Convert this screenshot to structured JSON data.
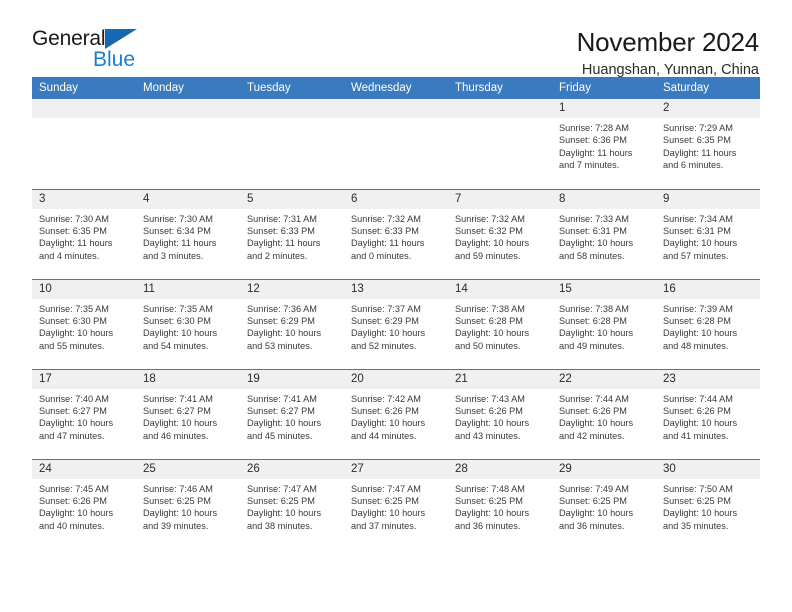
{
  "logo": {
    "word_one": "General",
    "word_two": "Blue",
    "triangle_icon": "blue-triangle-icon",
    "accent_color": "#1668b3",
    "blue_text_color": "#1b7fd4"
  },
  "header": {
    "title": "November 2024",
    "subtitle": "Huangshan, Yunnan, China"
  },
  "theme": {
    "header_row_bg": "#3a7abf",
    "header_row_text": "#ffffff",
    "daynum_band_bg": "#f0f0f0",
    "row_divider": "#3a7abf"
  },
  "weekdays": [
    "Sunday",
    "Monday",
    "Tuesday",
    "Wednesday",
    "Thursday",
    "Friday",
    "Saturday"
  ],
  "labels": {
    "sunrise_prefix": "Sunrise:",
    "sunset_prefix": "Sunset:",
    "daylight_prefix": "Daylight:"
  },
  "weeks": [
    [
      {
        "day": "",
        "empty": true
      },
      {
        "day": "",
        "empty": true
      },
      {
        "day": "",
        "empty": true
      },
      {
        "day": "",
        "empty": true
      },
      {
        "day": "",
        "empty": true
      },
      {
        "day": "1",
        "sunrise": "Sunrise: 7:28 AM",
        "sunset": "Sunset: 6:36 PM",
        "daylight": "Daylight: 11 hours and 7 minutes."
      },
      {
        "day": "2",
        "sunrise": "Sunrise: 7:29 AM",
        "sunset": "Sunset: 6:35 PM",
        "daylight": "Daylight: 11 hours and 6 minutes."
      }
    ],
    [
      {
        "day": "3",
        "sunrise": "Sunrise: 7:30 AM",
        "sunset": "Sunset: 6:35 PM",
        "daylight": "Daylight: 11 hours and 4 minutes."
      },
      {
        "day": "4",
        "sunrise": "Sunrise: 7:30 AM",
        "sunset": "Sunset: 6:34 PM",
        "daylight": "Daylight: 11 hours and 3 minutes."
      },
      {
        "day": "5",
        "sunrise": "Sunrise: 7:31 AM",
        "sunset": "Sunset: 6:33 PM",
        "daylight": "Daylight: 11 hours and 2 minutes."
      },
      {
        "day": "6",
        "sunrise": "Sunrise: 7:32 AM",
        "sunset": "Sunset: 6:33 PM",
        "daylight": "Daylight: 11 hours and 0 minutes."
      },
      {
        "day": "7",
        "sunrise": "Sunrise: 7:32 AM",
        "sunset": "Sunset: 6:32 PM",
        "daylight": "Daylight: 10 hours and 59 minutes."
      },
      {
        "day": "8",
        "sunrise": "Sunrise: 7:33 AM",
        "sunset": "Sunset: 6:31 PM",
        "daylight": "Daylight: 10 hours and 58 minutes."
      },
      {
        "day": "9",
        "sunrise": "Sunrise: 7:34 AM",
        "sunset": "Sunset: 6:31 PM",
        "daylight": "Daylight: 10 hours and 57 minutes."
      }
    ],
    [
      {
        "day": "10",
        "sunrise": "Sunrise: 7:35 AM",
        "sunset": "Sunset: 6:30 PM",
        "daylight": "Daylight: 10 hours and 55 minutes."
      },
      {
        "day": "11",
        "sunrise": "Sunrise: 7:35 AM",
        "sunset": "Sunset: 6:30 PM",
        "daylight": "Daylight: 10 hours and 54 minutes."
      },
      {
        "day": "12",
        "sunrise": "Sunrise: 7:36 AM",
        "sunset": "Sunset: 6:29 PM",
        "daylight": "Daylight: 10 hours and 53 minutes."
      },
      {
        "day": "13",
        "sunrise": "Sunrise: 7:37 AM",
        "sunset": "Sunset: 6:29 PM",
        "daylight": "Daylight: 10 hours and 52 minutes."
      },
      {
        "day": "14",
        "sunrise": "Sunrise: 7:38 AM",
        "sunset": "Sunset: 6:28 PM",
        "daylight": "Daylight: 10 hours and 50 minutes."
      },
      {
        "day": "15",
        "sunrise": "Sunrise: 7:38 AM",
        "sunset": "Sunset: 6:28 PM",
        "daylight": "Daylight: 10 hours and 49 minutes."
      },
      {
        "day": "16",
        "sunrise": "Sunrise: 7:39 AM",
        "sunset": "Sunset: 6:28 PM",
        "daylight": "Daylight: 10 hours and 48 minutes."
      }
    ],
    [
      {
        "day": "17",
        "sunrise": "Sunrise: 7:40 AM",
        "sunset": "Sunset: 6:27 PM",
        "daylight": "Daylight: 10 hours and 47 minutes."
      },
      {
        "day": "18",
        "sunrise": "Sunrise: 7:41 AM",
        "sunset": "Sunset: 6:27 PM",
        "daylight": "Daylight: 10 hours and 46 minutes."
      },
      {
        "day": "19",
        "sunrise": "Sunrise: 7:41 AM",
        "sunset": "Sunset: 6:27 PM",
        "daylight": "Daylight: 10 hours and 45 minutes."
      },
      {
        "day": "20",
        "sunrise": "Sunrise: 7:42 AM",
        "sunset": "Sunset: 6:26 PM",
        "daylight": "Daylight: 10 hours and 44 minutes."
      },
      {
        "day": "21",
        "sunrise": "Sunrise: 7:43 AM",
        "sunset": "Sunset: 6:26 PM",
        "daylight": "Daylight: 10 hours and 43 minutes."
      },
      {
        "day": "22",
        "sunrise": "Sunrise: 7:44 AM",
        "sunset": "Sunset: 6:26 PM",
        "daylight": "Daylight: 10 hours and 42 minutes."
      },
      {
        "day": "23",
        "sunrise": "Sunrise: 7:44 AM",
        "sunset": "Sunset: 6:26 PM",
        "daylight": "Daylight: 10 hours and 41 minutes."
      }
    ],
    [
      {
        "day": "24",
        "sunrise": "Sunrise: 7:45 AM",
        "sunset": "Sunset: 6:26 PM",
        "daylight": "Daylight: 10 hours and 40 minutes."
      },
      {
        "day": "25",
        "sunrise": "Sunrise: 7:46 AM",
        "sunset": "Sunset: 6:25 PM",
        "daylight": "Daylight: 10 hours and 39 minutes."
      },
      {
        "day": "26",
        "sunrise": "Sunrise: 7:47 AM",
        "sunset": "Sunset: 6:25 PM",
        "daylight": "Daylight: 10 hours and 38 minutes."
      },
      {
        "day": "27",
        "sunrise": "Sunrise: 7:47 AM",
        "sunset": "Sunset: 6:25 PM",
        "daylight": "Daylight: 10 hours and 37 minutes."
      },
      {
        "day": "28",
        "sunrise": "Sunrise: 7:48 AM",
        "sunset": "Sunset: 6:25 PM",
        "daylight": "Daylight: 10 hours and 36 minutes."
      },
      {
        "day": "29",
        "sunrise": "Sunrise: 7:49 AM",
        "sunset": "Sunset: 6:25 PM",
        "daylight": "Daylight: 10 hours and 36 minutes."
      },
      {
        "day": "30",
        "sunrise": "Sunrise: 7:50 AM",
        "sunset": "Sunset: 6:25 PM",
        "daylight": "Daylight: 10 hours and 35 minutes."
      }
    ]
  ]
}
